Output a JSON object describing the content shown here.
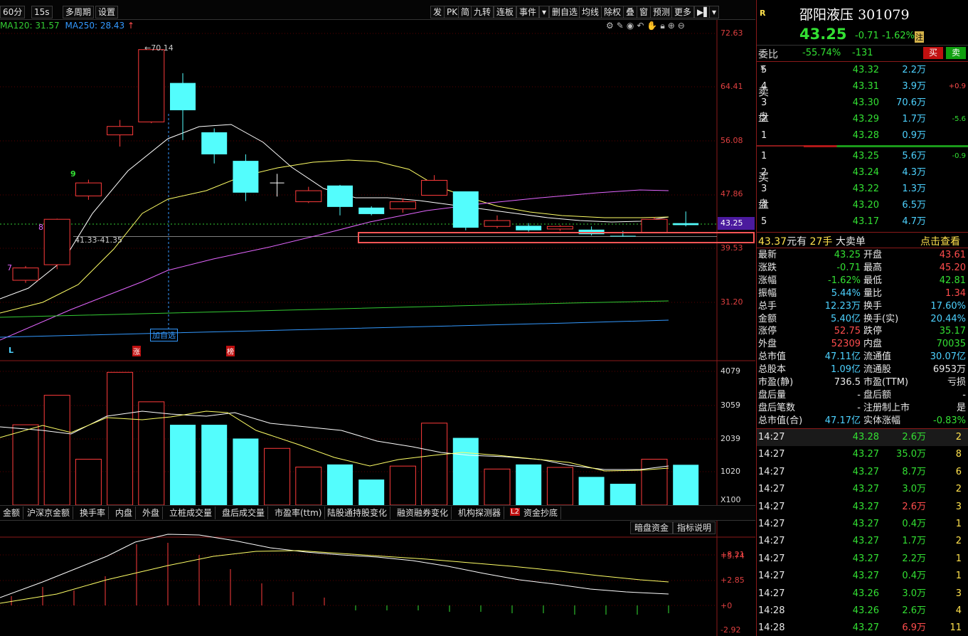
{
  "toolbar": {
    "left_buttons": [
      "60分",
      "15s",
      "多周期",
      "设置"
    ],
    "right_buttons": [
      "发",
      "PK",
      "简",
      "九转",
      "连板",
      "事件",
      "删自选",
      "均线",
      "除权",
      "叠",
      "窗",
      "预测",
      "更多"
    ],
    "ma120_text": "MA120: 31.57",
    "ma250_text": "MA250: 28.43",
    "ma_arrow": "↑"
  },
  "main_chart": {
    "price_labels": [
      "72.63",
      "64.41",
      "56.08",
      "47.86",
      "39.53",
      "31.20"
    ],
    "current_price_tag": "43.25",
    "high_label": "70.14",
    "range_label": "41.33-41.35",
    "add_watchlist_label": "加自选",
    "markers": [
      "7",
      "8",
      "9"
    ],
    "bottom_markers": [
      "L",
      "涨",
      "榜"
    ],
    "colors": {
      "up": "#ff3b3b",
      "down": "#53fdfd",
      "ma_white": "#ffffff",
      "ma_yellow": "#ffff66",
      "ma_magenta": "#e466ff",
      "ma_green": "#33cc33",
      "ma_blue": "#3399ff",
      "highlight": "#ff5555"
    }
  },
  "chart_data": {
    "type": "candlestick",
    "candles": [
      {
        "o": 36.5,
        "c": 34.6,
        "h": 36.8,
        "l": 34.2,
        "dir": "up"
      },
      {
        "o": 44.0,
        "c": 37.0,
        "h": 44.1,
        "l": 36.3,
        "dir": "up"
      },
      {
        "o": 49.6,
        "c": 47.6,
        "h": 50.1,
        "l": 47.0,
        "dir": "up"
      },
      {
        "o": 58.3,
        "c": 57.0,
        "h": 59.3,
        "l": 55.2,
        "dir": "up"
      },
      {
        "o": 70.14,
        "c": 59.0,
        "h": 70.14,
        "l": 58.8,
        "dir": "up"
      },
      {
        "o": 65.0,
        "c": 60.8,
        "h": 66.5,
        "l": 56.2,
        "dir": "down"
      },
      {
        "o": 57.4,
        "c": 54.0,
        "h": 58.0,
        "l": 52.6,
        "dir": "down"
      },
      {
        "o": 53.0,
        "c": 48.1,
        "h": 54.0,
        "l": 46.8,
        "dir": "down"
      },
      {
        "o": 49.5,
        "c": 49.6,
        "h": 51.0,
        "l": 47.5,
        "dir": "doji"
      },
      {
        "o": 48.4,
        "c": 46.7,
        "h": 49.0,
        "l": 46.5,
        "dir": "up"
      },
      {
        "o": 49.2,
        "c": 45.9,
        "h": 49.3,
        "l": 44.6,
        "dir": "down"
      },
      {
        "o": 45.8,
        "c": 44.8,
        "h": 46.0,
        "l": 44.6,
        "dir": "down"
      },
      {
        "o": 46.7,
        "c": 45.6,
        "h": 47.2,
        "l": 45.0,
        "dir": "up"
      },
      {
        "o": 50.0,
        "c": 47.7,
        "h": 50.8,
        "l": 47.7,
        "dir": "up"
      },
      {
        "o": 48.3,
        "c": 42.7,
        "h": 48.3,
        "l": 42.3,
        "dir": "down"
      },
      {
        "o": 43.8,
        "c": 42.9,
        "h": 44.6,
        "l": 42.6,
        "dir": "up"
      },
      {
        "o": 43.0,
        "c": 42.3,
        "h": 43.4,
        "l": 42.1,
        "dir": "down"
      },
      {
        "o": 42.9,
        "c": 42.5,
        "h": 43.1,
        "l": 42.2,
        "dir": "up"
      },
      {
        "o": 42.4,
        "c": 41.7,
        "h": 42.9,
        "l": 41.5,
        "dir": "down"
      },
      {
        "o": 41.45,
        "c": 41.35,
        "h": 42.2,
        "l": 41.33,
        "dir": "down"
      },
      {
        "o": 44.0,
        "c": 42.0,
        "h": 44.3,
        "l": 41.9,
        "dir": "up"
      },
      {
        "o": 43.4,
        "c": 43.1,
        "h": 45.2,
        "l": 42.9,
        "dir": "down"
      }
    ],
    "volume_axis": [
      "4079",
      "3059",
      "2039",
      "1020",
      "X100"
    ],
    "volume": [
      2450,
      3350,
      1400,
      4050,
      3150,
      2450,
      2450,
      2030,
      1730,
      1160,
      1240,
      780,
      1190,
      2500,
      2050,
      1100,
      1240,
      1150,
      860,
      650,
      1400,
      1230
    ],
    "macd_axis": [
      "+8.21",
      "+5.74",
      "+2.85",
      "+0",
      "-2.92"
    ]
  },
  "bottom_tabs": [
    "金额",
    "沪深京金额",
    "换手率",
    "内盘",
    "外盘",
    "立桩成交量",
    "盘后成交量",
    "市盈率(ttm)",
    "陆股通持股变化",
    "融资融券变化",
    "机构探测器",
    "L2",
    "资金抄底"
  ],
  "macd_buttons": [
    "暗盘资金",
    "指标说明"
  ],
  "panel": {
    "badge": "R",
    "name": "邵阳液压",
    "code": "301079",
    "price": "43.25",
    "change": "-0.71",
    "change_pct": "-1.62%",
    "pct_badge": "注",
    "weibi_label": "委比",
    "weibi_pct": "-55.74%",
    "weibi_diff": "-131",
    "buy_btn": "买",
    "sell_btn": "卖",
    "sell_label_1": "卖",
    "sell_label_2": "盘",
    "buy_label_1": "买",
    "buy_label_2": "盘",
    "yen": "¥",
    "asks": [
      {
        "lvl": "5",
        "price": "43.32",
        "vol": "2.2万",
        "chg": ""
      },
      {
        "lvl": "4",
        "price": "43.31",
        "vol": "3.9万",
        "chg": "+0.9"
      },
      {
        "lvl": "3",
        "price": "43.30",
        "vol": "70.6万",
        "chg": ""
      },
      {
        "lvl": "2",
        "price": "43.29",
        "vol": "1.7万",
        "chg": "-5.6"
      },
      {
        "lvl": "1",
        "price": "43.28",
        "vol": "0.9万",
        "chg": ""
      }
    ],
    "bids": [
      {
        "lvl": "1",
        "price": "43.25",
        "vol": "5.6万",
        "chg": "-0.9"
      },
      {
        "lvl": "2",
        "price": "43.24",
        "vol": "4.3万",
        "chg": ""
      },
      {
        "lvl": "3",
        "price": "43.22",
        "vol": "1.3万",
        "chg": ""
      },
      {
        "lvl": "4",
        "price": "43.20",
        "vol": "6.5万",
        "chg": ""
      },
      {
        "lvl": "5",
        "price": "43.17",
        "vol": "4.7万",
        "chg": ""
      }
    ],
    "big_order": {
      "price": "43.37",
      "unit": "元有",
      "qty": "27手",
      "label": "大卖单",
      "link": "点击查看"
    },
    "stats": [
      {
        "l1": "最新",
        "v1": "43.25",
        "c1": "green",
        "l2": "开盘",
        "v2": "43.61",
        "c2": "red"
      },
      {
        "l1": "涨跌",
        "v1": "-0.71",
        "c1": "green",
        "l2": "最高",
        "v2": "45.20",
        "c2": "red"
      },
      {
        "l1": "涨幅",
        "v1": "-1.62%",
        "c1": "green",
        "l2": "最低",
        "v2": "42.81",
        "c2": "green"
      },
      {
        "l1": "振幅",
        "v1": "5.44%",
        "c1": "cyan",
        "l2": "量比",
        "v2": "1.34",
        "c2": "red"
      },
      {
        "l1": "总手",
        "v1": "12.23万",
        "c1": "cyan",
        "l2": "换手",
        "v2": "17.60%",
        "c2": "cyan"
      },
      {
        "l1": "金额",
        "v1": "5.40亿",
        "c1": "cyan",
        "l2": "换手(实)",
        "v2": "20.44%",
        "c2": "cyan"
      },
      {
        "l1": "涨停",
        "v1": "52.75",
        "c1": "red",
        "l2": "跌停",
        "v2": "35.17",
        "c2": "green"
      },
      {
        "l1": "外盘",
        "v1": "52309",
        "c1": "red",
        "l2": "内盘",
        "v2": "70035",
        "c2": "green"
      },
      {
        "l1": "总市值",
        "v1": "47.11亿",
        "c1": "cyan",
        "l2": "流通值",
        "v2": "30.07亿",
        "c2": "cyan"
      },
      {
        "l1": "总股本",
        "v1": "1.09亿",
        "c1": "cyan",
        "l2": "流通股",
        "v2": "6953万",
        "c2": "white"
      },
      {
        "l1": "市盈(静)",
        "v1": "736.5",
        "c1": "white",
        "l2": "市盈(TTM)",
        "v2": "亏损",
        "c2": "white"
      },
      {
        "l1": "盘后量",
        "v1": "-",
        "c1": "white",
        "l2": "盘后额",
        "v2": "-",
        "c2": "white"
      },
      {
        "l1": "盘后笔数",
        "v1": "-",
        "c1": "white",
        "l2": "注册制上市",
        "v2": "是",
        "c2": "white"
      },
      {
        "l1": "总市值(合)",
        "v1": "47.17亿",
        "c1": "cyan",
        "l2": "实体涨幅",
        "v2": "-0.83%",
        "c2": "green"
      }
    ],
    "ticks": [
      {
        "t": "14:27",
        "p": "43.28",
        "v": "2.6万",
        "vc": "green",
        "n": "2"
      },
      {
        "t": "14:27",
        "p": "43.27",
        "v": "35.0万",
        "vc": "green",
        "n": "8"
      },
      {
        "t": "14:27",
        "p": "43.27",
        "v": "8.7万",
        "vc": "green",
        "n": "6"
      },
      {
        "t": "14:27",
        "p": "43.27",
        "v": "3.0万",
        "vc": "green",
        "n": "2"
      },
      {
        "t": "14:27",
        "p": "43.27",
        "v": "2.6万",
        "vc": "red",
        "n": "3"
      },
      {
        "t": "14:27",
        "p": "43.27",
        "v": "0.4万",
        "vc": "green",
        "n": "1"
      },
      {
        "t": "14:27",
        "p": "43.27",
        "v": "1.7万",
        "vc": "green",
        "n": "2"
      },
      {
        "t": "14:27",
        "p": "43.27",
        "v": "2.2万",
        "vc": "green",
        "n": "1"
      },
      {
        "t": "14:27",
        "p": "43.27",
        "v": "0.4万",
        "vc": "green",
        "n": "1"
      },
      {
        "t": "14:27",
        "p": "43.26",
        "v": "3.0万",
        "vc": "green",
        "n": "3"
      },
      {
        "t": "14:28",
        "p": "43.26",
        "v": "2.6万",
        "vc": "green",
        "n": "4"
      },
      {
        "t": "14:28",
        "p": "43.27",
        "v": "6.9万",
        "vc": "red",
        "n": "11"
      }
    ]
  }
}
